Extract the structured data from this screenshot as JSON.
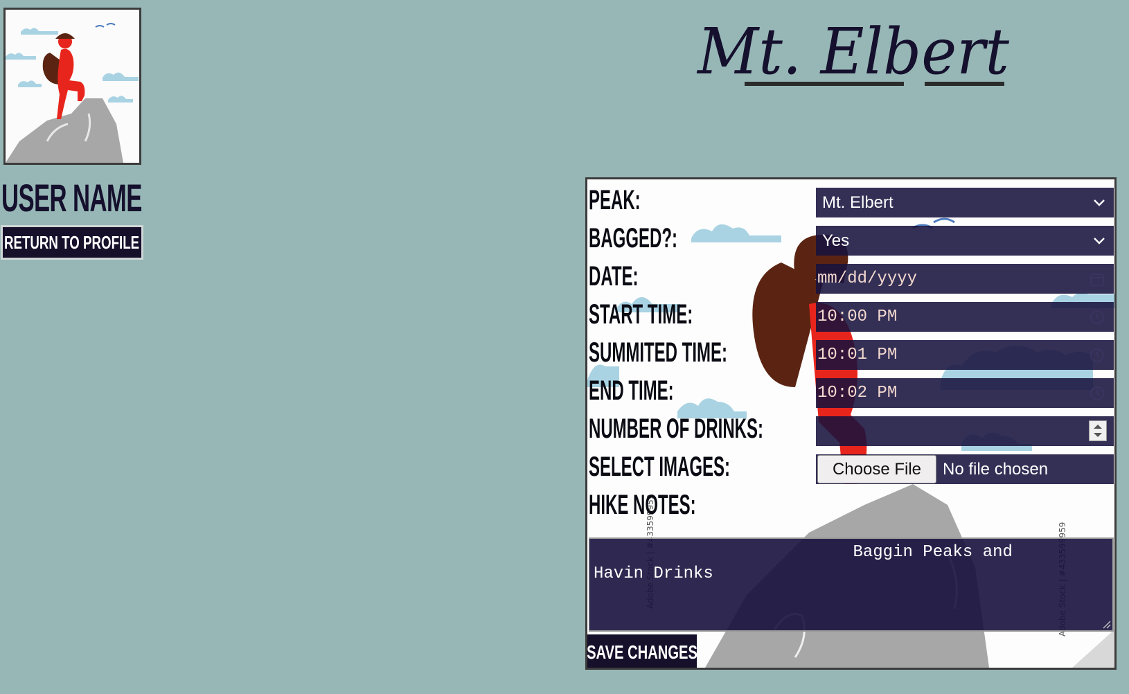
{
  "profile": {
    "user_name": "USER NAME",
    "return_button": "RETURN TO PROFILE"
  },
  "title": "Mt. Elbert",
  "form": {
    "labels": {
      "peak": "PEAK:",
      "bagged": "BAGGED?:",
      "date": "DATE:",
      "start_time": "START TIME:",
      "summited_time": "SUMMITED TIME:",
      "end_time": "END TIME:",
      "drinks": "NUMBER OF DRINKS:",
      "images": "SELECT IMAGES:",
      "notes": "HIKE NOTES:"
    },
    "peak_value": "Mt. Elbert",
    "bagged_value": "Yes",
    "date_placeholder": "mm/dd/yyyy",
    "start_time_value": "10:00 PM",
    "summited_time_value": "10:01 PM",
    "end_time_value": "10:02 PM",
    "drinks_value": "",
    "file_button": "Choose File",
    "file_status": "No file chosen",
    "notes_value": "                          Baggin Peaks and\nHavin Drinks",
    "save_button": "SAVE CHANGES"
  },
  "watermark": "Adobe Stock | #433599959",
  "colors": {
    "background": "#97b7b6",
    "dark_navy": "#16102b",
    "control_fill": "#1f1a46",
    "hiker_red": "#e8251c",
    "backpack_brown": "#5b2412",
    "cloud_blue": "#a9d3e3",
    "rock_gray": "#a7a7a7"
  }
}
